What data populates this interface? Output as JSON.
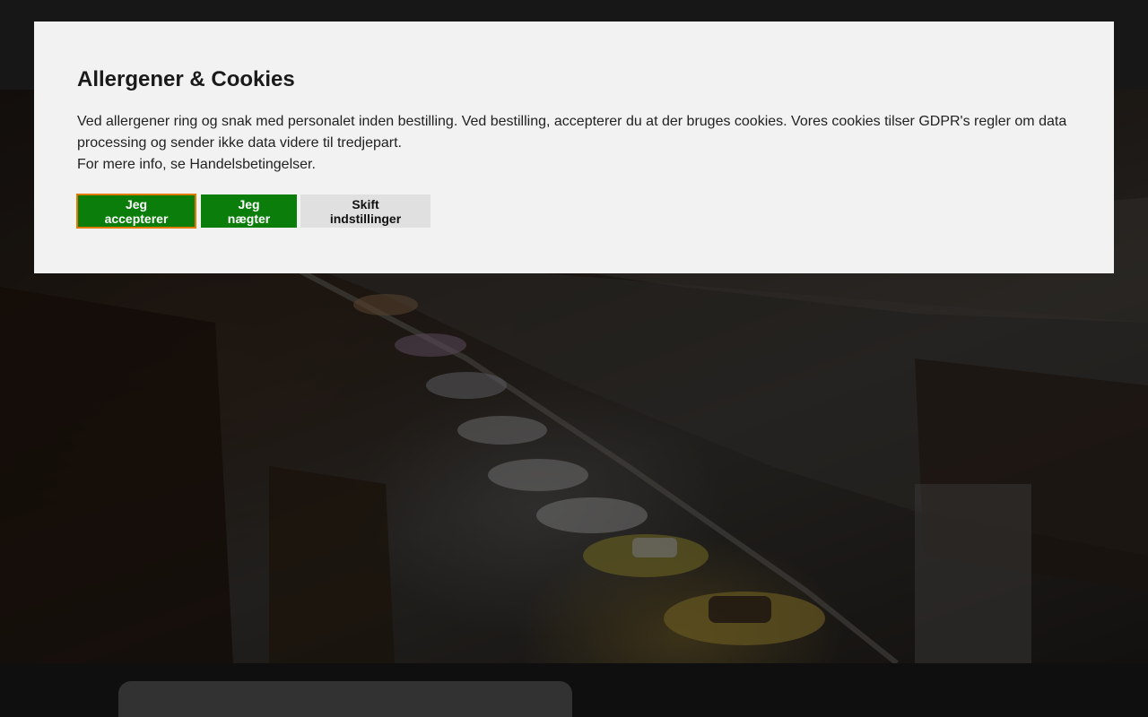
{
  "cookie_dialog": {
    "title": "Allergener & Cookies",
    "line1": "Ved allergener ring og snak med personalet inden bestilling. Ved bestilling, accepterer du at der bruges cookies. Vores cookies tilser GDPR's regler om data processing og sender ikke data videre til tredjepart.",
    "line2": "For mere info, se Handelsbetingelser.",
    "buttons": {
      "accept": "Jeg accepterer",
      "deny": "Jeg nægter",
      "settings": "Skift indstillinger"
    }
  },
  "colors": {
    "accent_green": "#0a7d0a",
    "focus_ring": "#e07b00",
    "dialog_bg": "#f2f2f2"
  }
}
